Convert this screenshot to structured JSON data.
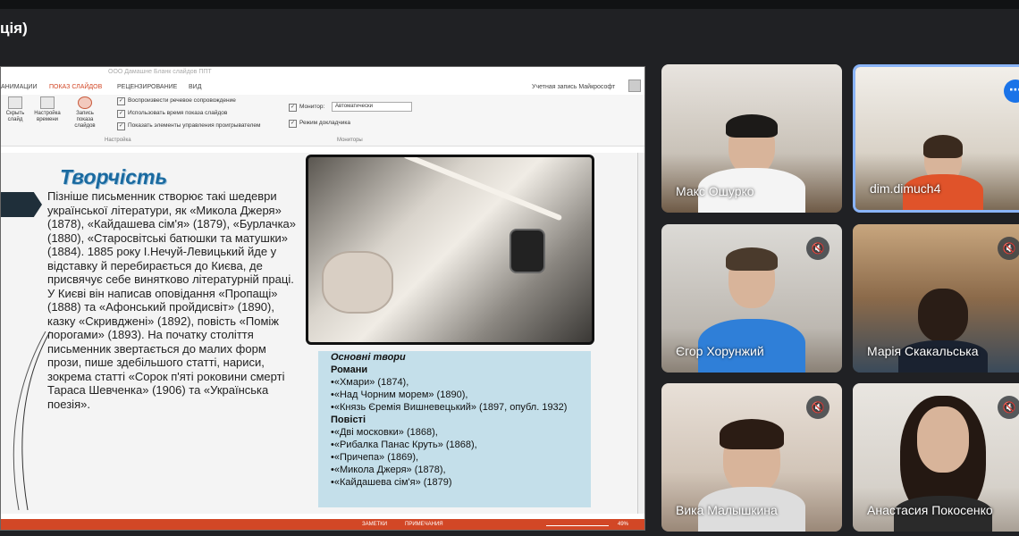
{
  "meeting": {
    "title": "ція)"
  },
  "ppt": {
    "title": "ООО Дамашне Бланк слайдов ППТ",
    "account": "Учетная запись Майкрософт",
    "tabs": [
      "АНИМАЦИИ",
      "ПОКАЗ СЛАЙДОВ",
      "РЕЦЕНЗИРОВАНИЕ",
      "ВИД"
    ],
    "ribbon_buttons": [
      "Скрыть слайд",
      "Настройка времени",
      "Запись показа слайдов"
    ],
    "ribbon_checks": [
      "Воспроизвести речевое сопровождение",
      "Использовать время показа слайдов",
      "Показать элементы управления проигрывателем"
    ],
    "monitor_label": "Монитор:",
    "monitor_value": "Автоматически",
    "presenter_check": "Режим докладчика",
    "group_setup": "Настройка",
    "group_monitors": "Мониторы",
    "status_left": "ЗАМЕТКИ",
    "status_mid": "ПРИМЕЧАНИЯ",
    "zoom": "49%"
  },
  "slide": {
    "heading": "Творчість",
    "body": "Пізніше письменник створює такі шедеври української літератури, як «Микола Джеря» (1878), «Кайдашева сім'я» (1879), «Бурлачка» (1880), «Старосвітські батюшки та матушки» (1884). 1885 року І.Нечуй-Левицький йде у відставку й перебирається до Києва, де присвячує себе винятково літературній праці. У Києві він написав оповідання «Пропащі» (1888) та «Афонський пройдисвіт» (1890), казку «Скривджені» (1892), повість «Поміж порогами» (1893). На початку століття письменник звертається до малих форм прози, пише здебільшого статті, нариси, зокрема статті «Сорок п'яті роковини смерті Тараса Шевченка» (1906) та «Українська поезія».",
    "theory_title": "Основні твори",
    "novels_title": "Романи",
    "novels": [
      "•«Хмари» (1874),",
      "•«Над Чорним морем» (1890),",
      "•«Князь Єремія Вишневецький» (1897, опубл. 1932)"
    ],
    "stories_title": "Повісті",
    "stories": [
      "•«Дві московки» (1868),",
      "•«Рибалка Панас Круть» (1868),",
      "•«Причепа» (1869),",
      "•«Микола Джеря» (1878),",
      "•«Кайдашева сім'я» (1879)"
    ]
  },
  "participants": [
    {
      "name": "Макс Ошурко",
      "muted": false,
      "active": false
    },
    {
      "name": "dim.dimuch4",
      "muted": false,
      "active": true
    },
    {
      "name": "Єгор Хорунжий",
      "muted": true,
      "active": false
    },
    {
      "name": "Марія Скакальська",
      "muted": true,
      "active": false
    },
    {
      "name": "Вика Малышкина",
      "muted": true,
      "active": false
    },
    {
      "name": "Анастасия Покосенко",
      "muted": true,
      "active": false
    }
  ],
  "icons": {
    "mic_off": "mic-off-icon",
    "more": "more-options-icon"
  },
  "colors": {
    "accent": "#8ab4f8",
    "ppt_accent": "#d24726",
    "meet_bg": "#202124"
  }
}
